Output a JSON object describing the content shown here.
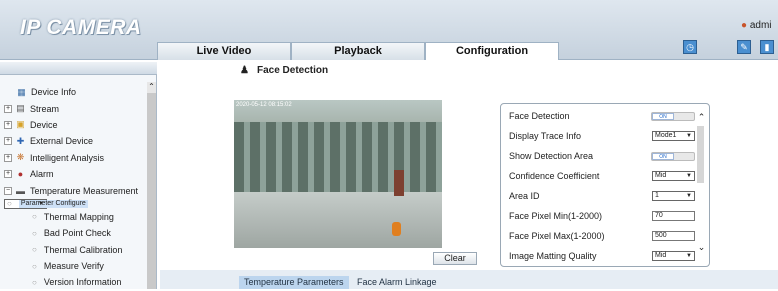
{
  "app": {
    "title": "IP CAMERA",
    "user": "admi"
  },
  "tabs": [
    {
      "label": "Live Video"
    },
    {
      "label": "Playback"
    },
    {
      "label": "Configuration"
    }
  ],
  "sidebar": {
    "items": [
      {
        "label": "Device Info",
        "icon": "device-info-icon"
      },
      {
        "label": "Stream",
        "icon": "stream-icon"
      },
      {
        "label": "Device",
        "icon": "device-icon"
      },
      {
        "label": "External Device",
        "icon": "external-device-icon"
      },
      {
        "label": "Intelligent Analysis",
        "icon": "analysis-icon"
      },
      {
        "label": "Alarm",
        "icon": "alarm-icon"
      },
      {
        "label": "Temperature Measurement",
        "icon": "temperature-icon"
      }
    ],
    "children": [
      {
        "label": "Parameter Configure"
      },
      {
        "label": "Thermal Mapping"
      },
      {
        "label": "Bad Point Check"
      },
      {
        "label": "Thermal Calibration"
      },
      {
        "label": "Measure Verify"
      },
      {
        "label": "Version Information"
      }
    ]
  },
  "page": {
    "title": "Face Detection"
  },
  "video": {
    "osd": "2020-05-12 08:15:02"
  },
  "buttons": {
    "clear": "Clear"
  },
  "settings": [
    {
      "label": "Face Detection",
      "value": "ON"
    },
    {
      "label": "Display Trace Info",
      "value": "Mode1"
    },
    {
      "label": "Show Detection Area",
      "value": "ON"
    },
    {
      "label": "Confidence Coefficient",
      "value": "Mid"
    },
    {
      "label": "Area ID",
      "value": "1"
    },
    {
      "label": "Face Pixel Min(1-2000)",
      "value": "70"
    },
    {
      "label": "Face Pixel Max(1-2000)",
      "value": "500"
    },
    {
      "label": "Image Matting Quality",
      "value": "Mid"
    }
  ],
  "bottom_tabs": [
    {
      "label": "Temperature Parameters"
    },
    {
      "label": "Face Alarm Linkage"
    }
  ]
}
